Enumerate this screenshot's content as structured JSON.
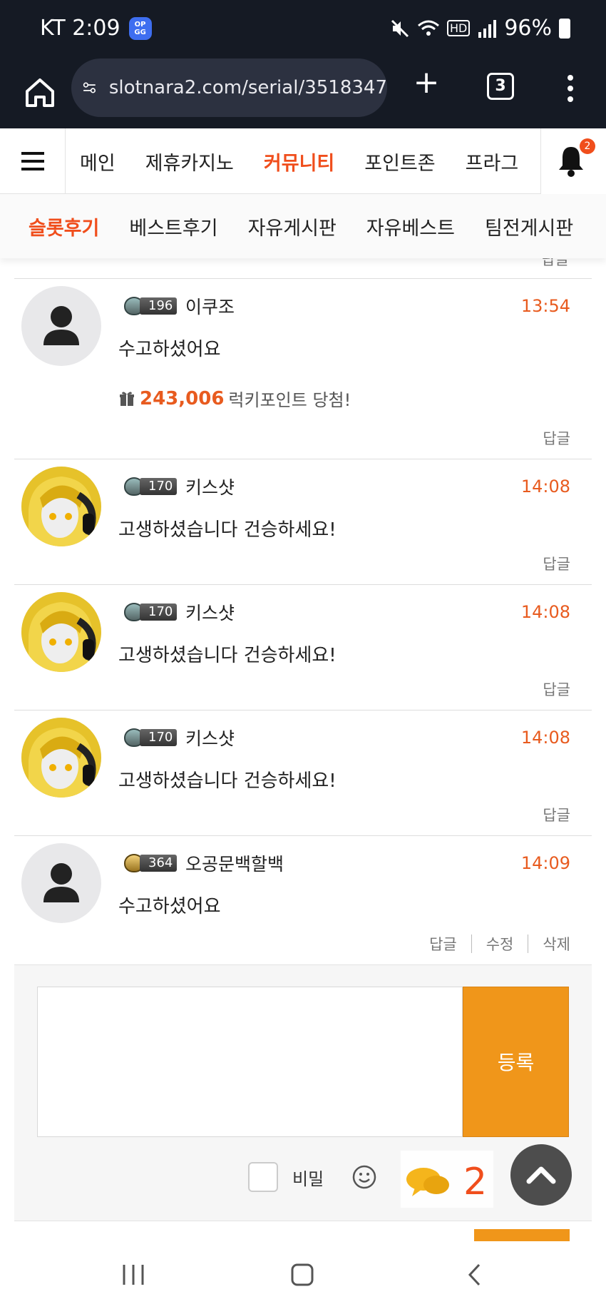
{
  "status_bar": {
    "carrier_time": "KT 2:09",
    "app_badge": "OP.GG",
    "hd_label": "HD",
    "battery": "96%"
  },
  "browser": {
    "url": "slotnara2.com/serial/3518347",
    "tab_count": "3"
  },
  "site_nav": {
    "items": [
      "메인",
      "제휴카지노",
      "커뮤니티",
      "포인트존",
      "프라그"
    ],
    "active": "커뮤니티",
    "notification_count": "2"
  },
  "sub_nav": {
    "items": [
      "슬롯후기",
      "베스트후기",
      "자유게시판",
      "자유베스트",
      "팀전게시판"
    ],
    "active": "슬롯후기"
  },
  "top_reply_label": "답글",
  "comments": [
    {
      "level": "196",
      "nickname": "이쿠조",
      "time": "13:54",
      "text": "수고하셨어요",
      "lucky_amount": "243,006",
      "lucky_text": "럭키포인트 당첨!",
      "actions": [
        "답글"
      ]
    },
    {
      "level": "170",
      "nickname": "키스샷",
      "time": "14:08",
      "text": "고생하셨습니다 건승하세요!",
      "actions": [
        "답글"
      ]
    },
    {
      "level": "170",
      "nickname": "키스샷",
      "time": "14:08",
      "text": "고생하셨습니다 건승하세요!",
      "actions": [
        "답글"
      ]
    },
    {
      "level": "170",
      "nickname": "키스샷",
      "time": "14:08",
      "text": "고생하셨습니다 건승하세요!",
      "actions": [
        "답글"
      ]
    },
    {
      "level": "364",
      "nickname": "오공문백할백",
      "time": "14:09",
      "text": "수고하셨어요",
      "actions": [
        "답글",
        "수정",
        "삭제"
      ]
    }
  ],
  "editor": {
    "placeholder": "",
    "submit_label": "등록",
    "secret_label": "비밀"
  },
  "floating": {
    "chat_count": "2"
  }
}
